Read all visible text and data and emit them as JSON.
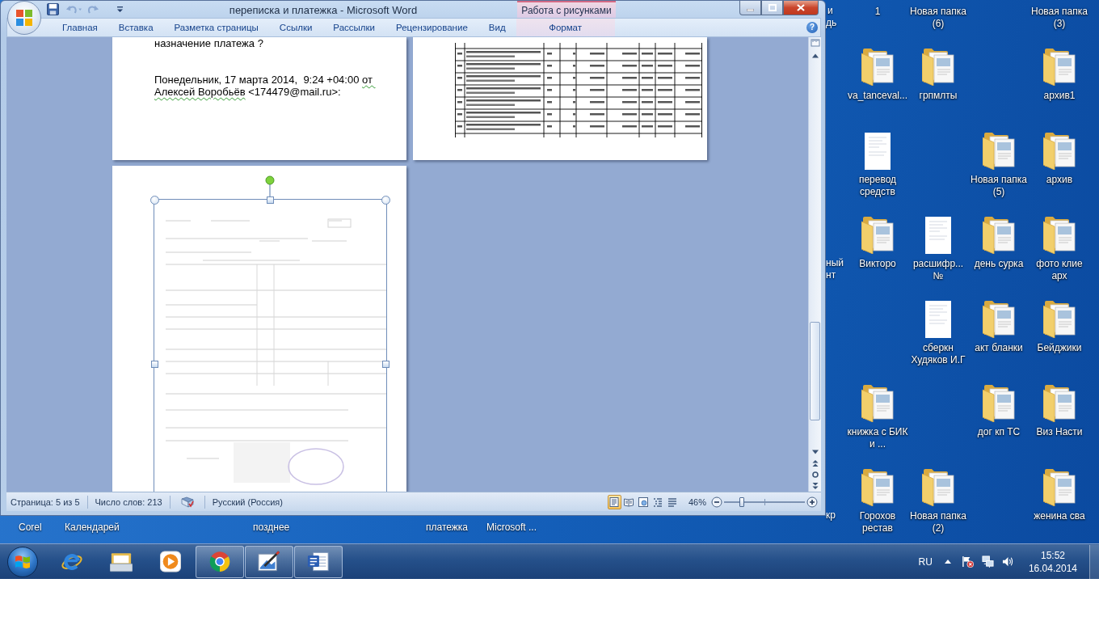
{
  "window": {
    "title": "переписка и платежка - Microsoft Word",
    "contextual_group": "Работа с рисунками"
  },
  "quick_access": [
    {
      "kind": "save",
      "disabled": false
    },
    {
      "kind": "undo",
      "disabled": true
    },
    {
      "kind": "redo",
      "disabled": true
    },
    {
      "kind": "customize",
      "disabled": false
    }
  ],
  "ribbon": {
    "tabs": [
      {
        "label": "Главная",
        "kind": "standard",
        "selected": false
      },
      {
        "label": "Вставка",
        "kind": "standard",
        "selected": false
      },
      {
        "label": "Разметка страницы",
        "kind": "standard",
        "selected": false
      },
      {
        "label": "Ссылки",
        "kind": "standard",
        "selected": false
      },
      {
        "label": "Рассылки",
        "kind": "standard",
        "selected": false
      },
      {
        "label": "Рецензирование",
        "kind": "standard",
        "selected": false
      },
      {
        "label": "Вид",
        "kind": "standard",
        "selected": false
      },
      {
        "label": "Формат",
        "kind": "contextual",
        "selected": false
      }
    ],
    "help": "?"
  },
  "document": {
    "page_1": {
      "heading_line": "назначение платежа ?",
      "message_header": [
        {
          "text": "Понедельник, 17 марта 2014,  9:24 +04:00 ",
          "grammar_flag": false
        },
        {
          "text": "от ",
          "grammar_flag": true
        },
        {
          "text": "Алексей Воробьёв",
          "grammar_flag": true
        },
        {
          "text": " <174479@mail.ru>:",
          "grammar_flag": false
        }
      ]
    },
    "page_3": {
      "picture": {
        "selected": true
      }
    }
  },
  "status_bar": {
    "page": "Страница: 5 из 5",
    "word_count": "Число слов: 213",
    "language": "Русский (Россия)",
    "views": [
      {
        "kind": "print_layout",
        "selected": true
      },
      {
        "kind": "full_screen_reading",
        "selected": false
      },
      {
        "kind": "web_layout",
        "selected": false
      },
      {
        "kind": "outline",
        "selected": false
      },
      {
        "kind": "draft",
        "selected": false
      }
    ],
    "zoom": "46%",
    "zoom_slider": {
      "level": 0.22
    }
  },
  "desktop": {
    "icons": [
      {
        "label": "1"
      },
      {
        "label": "Новая папка (6)"
      },
      {
        "label": "Новая папка (3)"
      },
      {
        "label": "va_tanceval...",
        "kind": "folder"
      },
      {
        "label": "грпмлты",
        "kind": "folder"
      },
      {
        "label": "архив1",
        "kind": "folder"
      },
      {
        "label": "перевод средств",
        "kind": "document"
      },
      {
        "label": "Новая папка (5)",
        "kind": "folder"
      },
      {
        "label": "архив",
        "kind": "folder"
      },
      {
        "label": "Викторо",
        "kind": "folder"
      },
      {
        "label": "расшифр... №",
        "kind": "document"
      },
      {
        "label": "день сурка",
        "kind": "folder"
      },
      {
        "label": "фото клие арх",
        "kind": "folder"
      },
      {
        "label": "сберкн Худяков И.Г",
        "kind": "document"
      },
      {
        "label": "акт бланки",
        "kind": "folder"
      },
      {
        "label": "Бейджики",
        "kind": "folder"
      },
      {
        "label": "книжка с БИК и ...",
        "kind": "folder"
      },
      {
        "label": "дог кп ТС",
        "kind": "folder"
      },
      {
        "label": "Виз Насти",
        "kind": "folder"
      },
      {
        "label": "Горохов рестав",
        "kind": "folder"
      },
      {
        "label": "Новая папка (2)",
        "kind": "folder"
      },
      {
        "label": "женина сва",
        "kind": "folder"
      }
    ],
    "covered_labels": [
      "и",
      "дь",
      "ный",
      "нт",
      "кр",
      "Corel",
      "Календарей",
      "позднее",
      "платежка",
      "Microsoft ..."
    ]
  },
  "taskbar": {
    "apps": [
      {
        "kind": "ie",
        "running": false
      },
      {
        "kind": "explorer",
        "running": false
      },
      {
        "kind": "media_player",
        "running": false
      },
      {
        "kind": "chrome",
        "running": true
      },
      {
        "kind": "paint",
        "running": true
      },
      {
        "kind": "word",
        "running": true
      }
    ],
    "language": "RU",
    "time": "15:52",
    "date": "16.04.2014"
  }
}
